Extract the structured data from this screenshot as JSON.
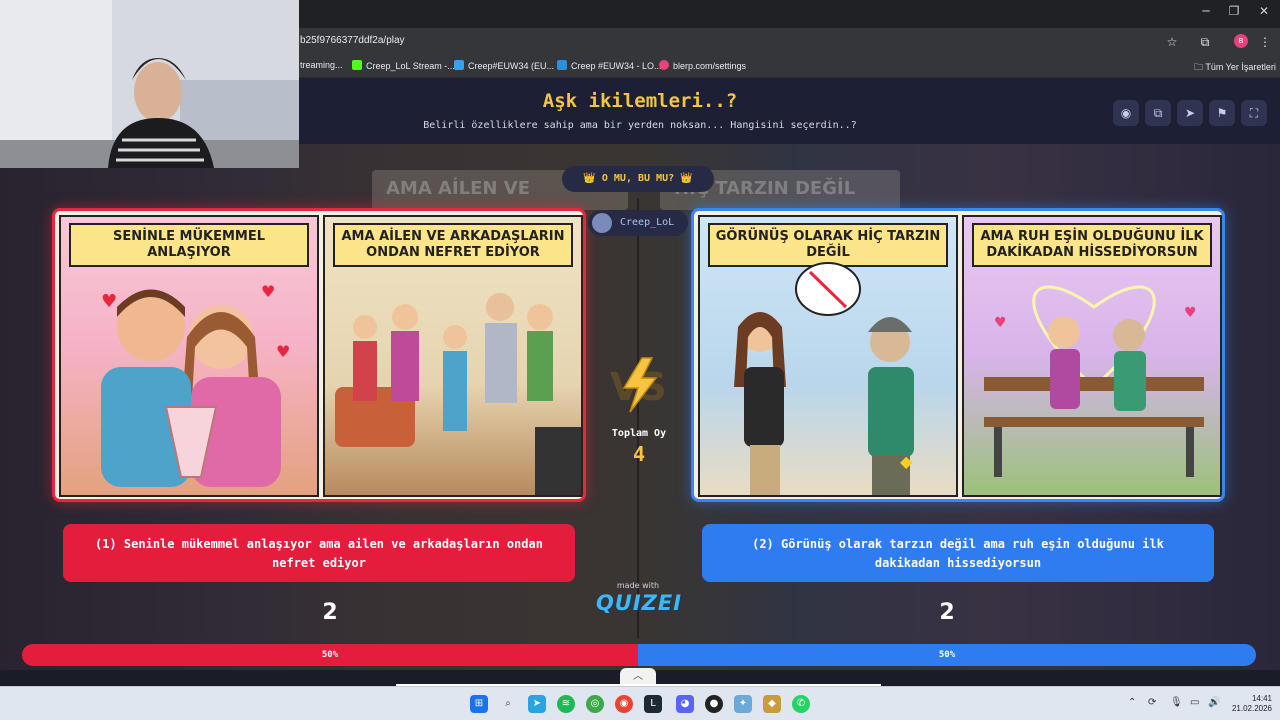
{
  "browser": {
    "url": "b25f9766377ddf2a/play",
    "bookmarks": [
      {
        "label": "treaming...",
        "color": "#35363a"
      },
      {
        "label": "Creep_LoL Stream -...",
        "color": "#53fc18"
      },
      {
        "label": "Creep#EUW34 (EU...",
        "color": "#3aa0e8"
      },
      {
        "label": "Creep #EUW34 - LO...",
        "color": "#2f8fd8"
      },
      {
        "label": "blerp.com/settings",
        "color": "#e8417b"
      }
    ],
    "all_bookmarks": "Tüm Yer İşaretleri",
    "profile_initial": "B"
  },
  "header": {
    "title": "Aşk ikilemleri..?",
    "subtitle": "Belirli özelliklere sahip ama bir yerden noksan... Hangisini seçerdin..?",
    "buttons": [
      "eye-icon",
      "copy-icon",
      "share-icon",
      "flag-icon",
      "fullscreen-icon"
    ]
  },
  "badge": {
    "text": "👑 O MU, BU MU? 👑"
  },
  "background_banners": [
    "AMA AİLEN VE",
    "HİÇ TARZIN DEĞİL"
  ],
  "streamer": {
    "name": "Creep_LoL"
  },
  "left": {
    "panels": [
      {
        "caption": "SENİNLE MÜKEMMEL ANLAŞIYOR"
      },
      {
        "caption": "AMA AİLEN VE ARKADAŞLARIN ONDAN NEFRET EDİYOR"
      }
    ],
    "option_text": "(1) Seninle mükemmel anlaşıyor ama ailen ve arkadaşların ondan nefret ediyor",
    "votes": "2",
    "percent_label": "50%",
    "percent": 0.5
  },
  "right": {
    "panels": [
      {
        "caption": "GÖRÜNÜŞ OLARAK HİÇ TARZIN DEĞİL"
      },
      {
        "caption": "AMA RUH EŞİN OLDUĞUNU İLK DAKİKADAN HİSSEDİYORSUN"
      }
    ],
    "option_text": "(2) Görünüş olarak tarzın değil ama ruh eşin olduğunu ilk dakikadan hissediyorsun",
    "votes": "2",
    "percent_label": "50%",
    "percent": 0.5
  },
  "totals": {
    "label": "Toplam Oy",
    "value": "4"
  },
  "footer": {
    "made_with": "made with",
    "brand": "QUIZEI"
  },
  "taskbar": {
    "time": "14:41",
    "date": "21.02.2026"
  },
  "colors": {
    "left_accent": "#e51d3c",
    "right_accent": "#2f7cf0",
    "title": "#f5c542"
  }
}
